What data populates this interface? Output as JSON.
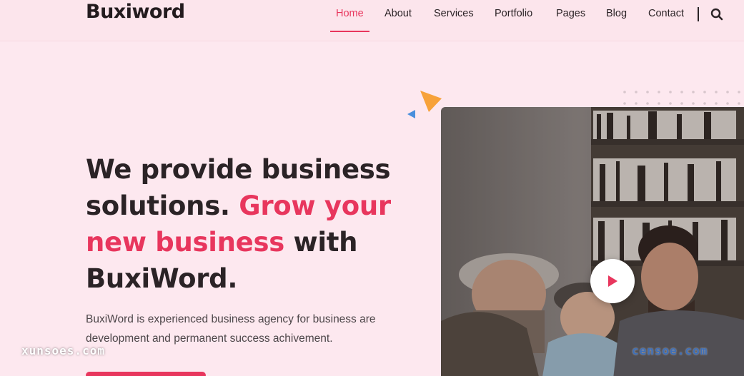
{
  "header": {
    "logo": "Buxiword",
    "nav": [
      {
        "label": "Home",
        "active": true
      },
      {
        "label": "About",
        "active": false
      },
      {
        "label": "Services",
        "active": false
      },
      {
        "label": "Portfolio",
        "active": false
      },
      {
        "label": "Pages",
        "active": false
      },
      {
        "label": "Blog",
        "active": false
      },
      {
        "label": "Contact",
        "active": false
      }
    ],
    "search_icon": "search-icon"
  },
  "hero": {
    "title_part1": "We provide business solutions.",
    "title_accent": "Grow your new business",
    "title_part2": "with BuxiWord.",
    "description": "BuxiWord is experienced business agency for business are development and permanent success achivement.",
    "video_icon": "play-icon"
  },
  "watermarks": {
    "left": "xunsoes.com",
    "right": "censoe.com"
  },
  "colors": {
    "accent": "#e8365d",
    "background": "#fde8ef",
    "text": "#2b2326",
    "deco_orange": "#f7a23a",
    "deco_blue": "#4a8fdc"
  }
}
